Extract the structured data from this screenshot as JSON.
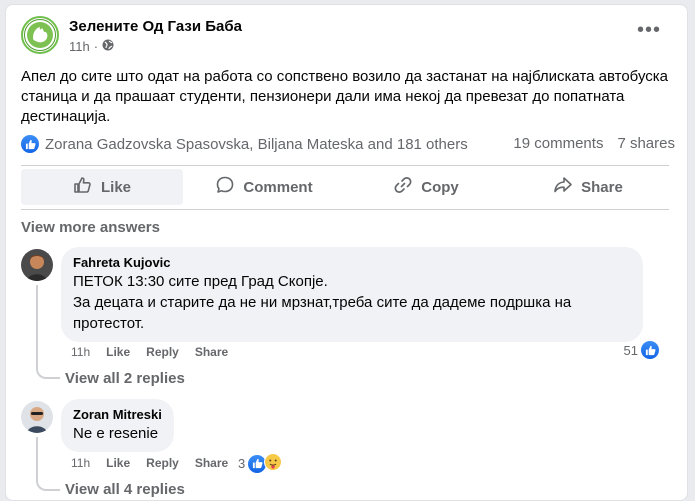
{
  "post": {
    "page_name": "Зелените Од Гази Баба",
    "time": "11h",
    "audience_icon": "globe-icon",
    "text": "Апел до сите што одат на работа со сопствено возило да застанат на најблиската автобуска станица и да прашаат студенти, пензионери  дали има некој да превезат до попатната дестинација.",
    "reactions_text": "Zorana Gadzovska Spasovska, Biljana Mateska and 181 others",
    "comments_count": "19 comments",
    "shares_count": "7 shares"
  },
  "actions": {
    "like": "Like",
    "comment": "Comment",
    "copy": "Copy",
    "share": "Share"
  },
  "view_more_answers": "View more answers",
  "comments": [
    {
      "author": "Fahreta Kujovic",
      "text_line1": "ПЕТОК 13:30 сите пред Град Скопје.",
      "text_line2": "За децата и старите да не ни мрзнат,треба сите да дадеме подршка на протестот.",
      "time": "11h",
      "like": "Like",
      "reply": "Reply",
      "share": "Share",
      "reaction_count": "51",
      "view_replies": "View all 2 replies"
    },
    {
      "author": "Zoran Mitreski",
      "text": "Ne e resenie",
      "time": "11h",
      "like": "Like",
      "reply": "Reply",
      "share": "Share",
      "reaction_count": "3",
      "view_replies": "View all 4 replies"
    }
  ],
  "colors": {
    "brand_blue": "#1877f2",
    "page_logo_green": "#6fbf4a",
    "secondary_text": "#65676b"
  }
}
